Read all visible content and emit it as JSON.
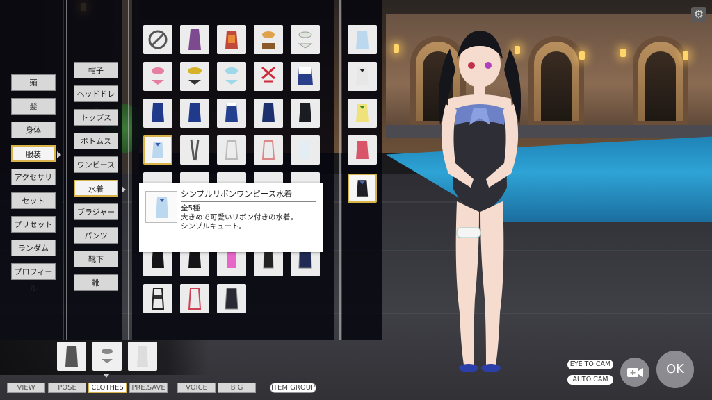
{
  "categories": [
    {
      "label": "頭"
    },
    {
      "label": "髪"
    },
    {
      "label": "身体"
    },
    {
      "label": "服装",
      "selected": true
    },
    {
      "label": "アクセサリ"
    },
    {
      "label": "セット"
    },
    {
      "label": "プリセット"
    },
    {
      "label": "ランダム"
    },
    {
      "label": "プロフィール"
    }
  ],
  "subcategories": [
    {
      "label": "帽子"
    },
    {
      "label": "ヘッドドレス"
    },
    {
      "label": "トップス"
    },
    {
      "label": "ボトムス"
    },
    {
      "label": "ワンピース"
    },
    {
      "label": "水着",
      "selected": true
    },
    {
      "label": "ブラジャー"
    },
    {
      "label": "パンツ"
    },
    {
      "label": "靴下"
    },
    {
      "label": "靴"
    }
  ],
  "tooltip": {
    "title": "シンプルリボンワンピース水着",
    "line1": "全5種",
    "line2": "大きめで可愛いリボン付きの水着。",
    "line3": "シンプルキュート。"
  },
  "bottom_tabs": [
    {
      "label": "VIEW"
    },
    {
      "label": "POSE"
    },
    {
      "label": "CLOTHES",
      "selected": true
    },
    {
      "label": "PRE.SAVE"
    },
    {
      "label": "VOICE"
    },
    {
      "label": "B G"
    },
    {
      "label": "ITEM GROUP"
    }
  ],
  "camera": {
    "eye_to_cam": "EYE TO CAM",
    "auto_cam": "AUTO CAM"
  },
  "ok_label": "OK",
  "icons": {
    "settings": "gear-icon",
    "none": "prohibited-icon",
    "camera": "video-camera-add-icon"
  },
  "colors": {
    "selected_border": "#d9b44a",
    "button_bg": "#d8d8d8",
    "panel_bg": "#06060e"
  }
}
